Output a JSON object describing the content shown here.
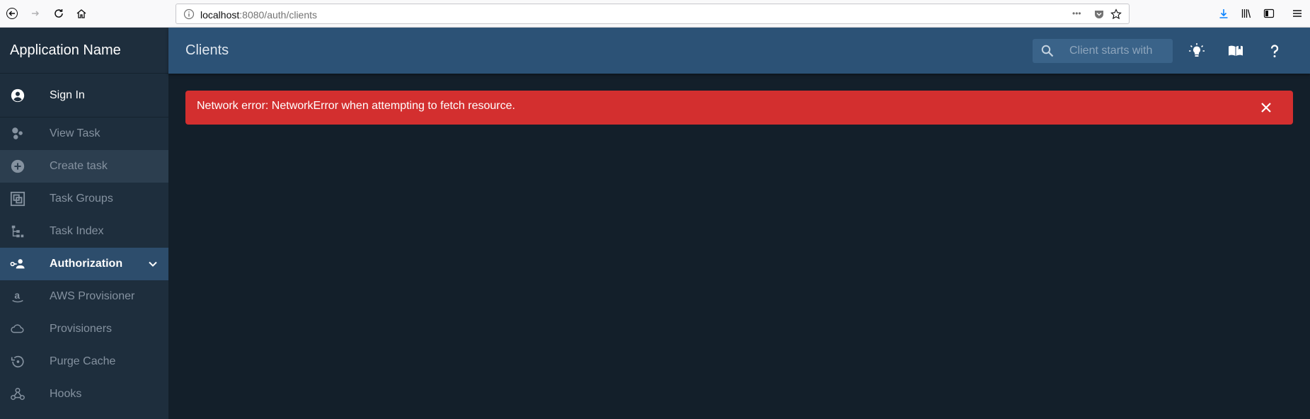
{
  "browser": {
    "url_host": "localhost",
    "url_rest": ":8080/auth/clients",
    "menu_dots": "•••"
  },
  "app": {
    "name": "Application Name",
    "page_title": "Clients"
  },
  "search": {
    "placeholder": "Client starts with",
    "value": ""
  },
  "sidebar": {
    "items": [
      {
        "label": "Sign In",
        "icon": "account-circle-icon"
      },
      {
        "label": "View Task",
        "icon": "bubbles-icon"
      },
      {
        "label": "Create task",
        "icon": "plus-circle-icon"
      },
      {
        "label": "Task Groups",
        "icon": "group-icon"
      },
      {
        "label": "Task Index",
        "icon": "file-tree-icon"
      },
      {
        "label": "Authorization",
        "icon": "account-key-icon"
      },
      {
        "label": "AWS Provisioner",
        "icon": "amazon-icon"
      },
      {
        "label": "Provisioners",
        "icon": "cloud-icon"
      },
      {
        "label": "Purge Cache",
        "icon": "history-icon"
      },
      {
        "label": "Hooks",
        "icon": "webhook-icon"
      }
    ]
  },
  "alert": {
    "message": "Network error: NetworkError when attempting to fetch resource."
  },
  "colors": {
    "sidebar_bg": "#1e2e3d",
    "appbar_bg": "#2c5276",
    "content_bg": "#131f2a",
    "active_item": "#2d4d6c",
    "alert_bg": "#d32f2f"
  }
}
